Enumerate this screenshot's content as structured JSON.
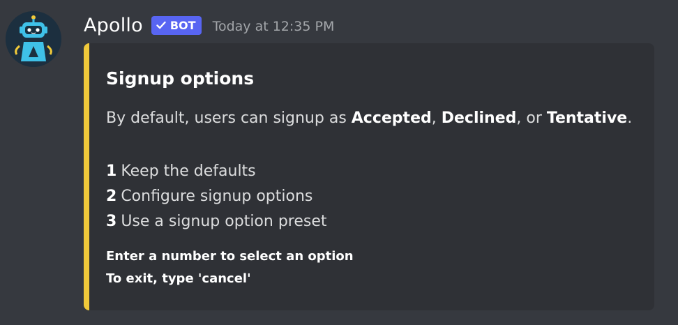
{
  "message": {
    "author": "Apollo",
    "bot_tag": "BOT",
    "timestamp": "Today at 12:35 PM",
    "avatar_icon": "robot-avatar-icon"
  },
  "embed": {
    "accent_color": "#f0c93a",
    "title": "Signup options",
    "description": {
      "prefix": "By default, users can signup as ",
      "accepted": "Accepted",
      "sep1": ", ",
      "declined": "Declined",
      "sep2": ", or ",
      "tentative": "Tentative",
      "suffix": "."
    },
    "options": [
      {
        "number": "1",
        "label": "Keep the defaults"
      },
      {
        "number": "2",
        "label": "Configure signup options"
      },
      {
        "number": "3",
        "label": "Use a signup option preset"
      }
    ],
    "footer": {
      "line1": "Enter a number to select an option",
      "line2": "To exit, type 'cancel'"
    }
  },
  "colors": {
    "background": "#36393f",
    "embed_background": "#2f3136",
    "bot_tag": "#5865f2"
  }
}
